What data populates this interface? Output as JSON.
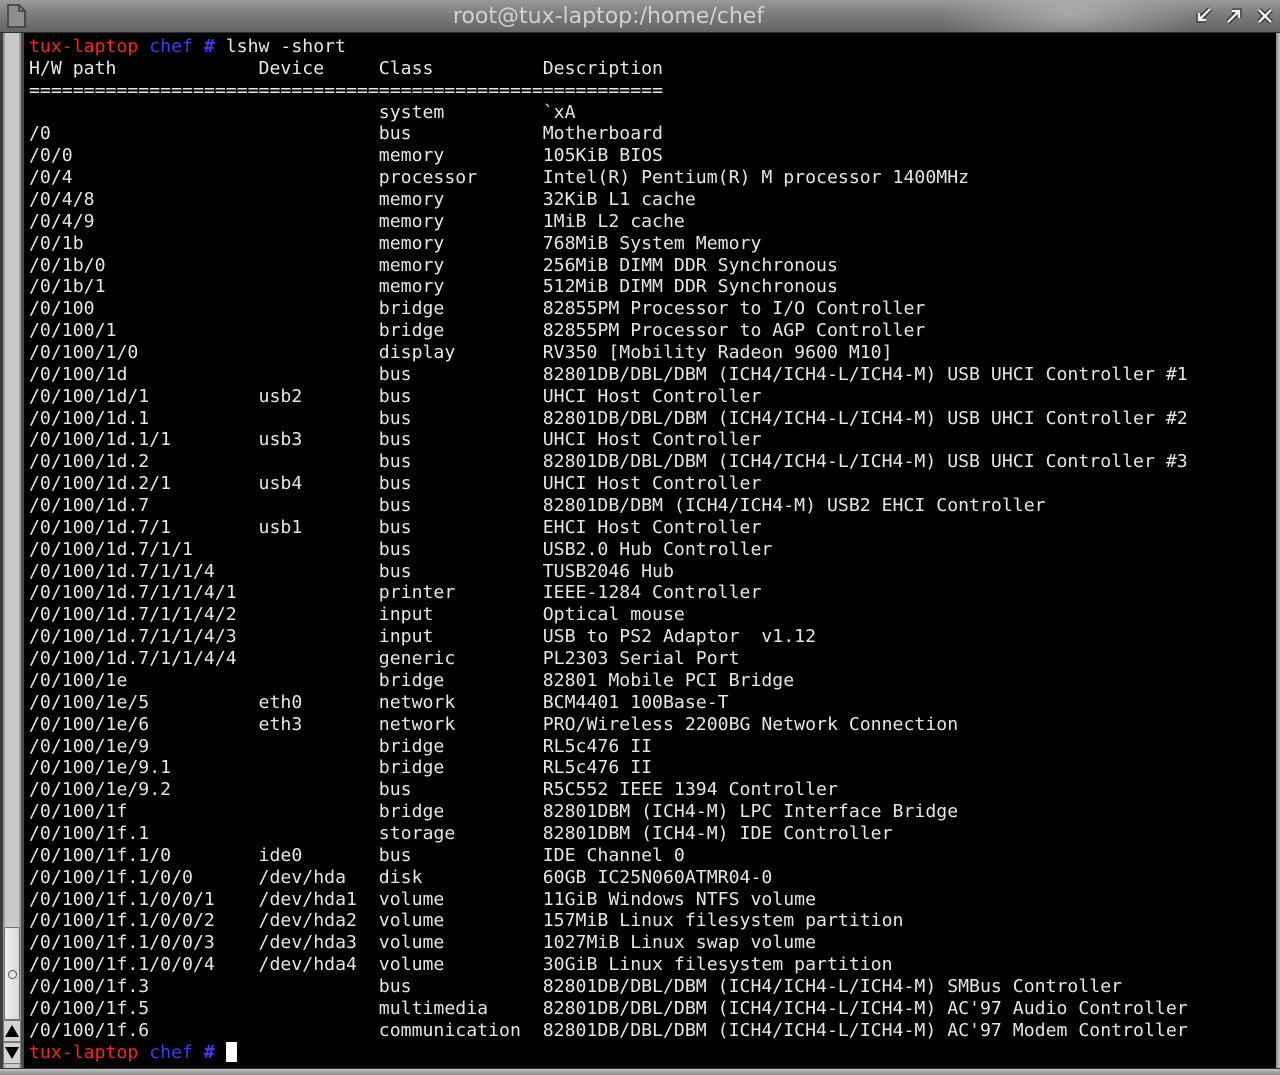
{
  "window": {
    "title": "root@tux-laptop:/home/chef",
    "menu_icon": "window-menu-icon",
    "button_icons": [
      "minimize-icon",
      "maximize-icon",
      "close-icon"
    ]
  },
  "colors": {
    "terminal_bg": "#000000",
    "terminal_fg": "#e6e6e6",
    "prompt_host": "#ff2222",
    "prompt_dir": "#3c3cff",
    "cursor": "#ffffff",
    "titlebar": "#7c7c7c",
    "title_text": "#d2d2d2"
  },
  "scrollbar": {
    "scroll_fraction": 1.0,
    "visible_fraction": 0.094
  },
  "terminal": {
    "prompt": {
      "host": "tux-laptop",
      "dir": "chef",
      "symbol": "#"
    },
    "command": "lshw -short",
    "headers": {
      "path": "H/W path",
      "device": "Device",
      "class": "Class",
      "description": "Description"
    },
    "separator": "==========================================================",
    "rows": [
      {
        "path": "",
        "device": "",
        "class": "system",
        "description": "`xA"
      },
      {
        "path": "/0",
        "device": "",
        "class": "bus",
        "description": "Motherboard"
      },
      {
        "path": "/0/0",
        "device": "",
        "class": "memory",
        "description": "105KiB BIOS"
      },
      {
        "path": "/0/4",
        "device": "",
        "class": "processor",
        "description": "Intel(R) Pentium(R) M processor 1400MHz"
      },
      {
        "path": "/0/4/8",
        "device": "",
        "class": "memory",
        "description": "32KiB L1 cache"
      },
      {
        "path": "/0/4/9",
        "device": "",
        "class": "memory",
        "description": "1MiB L2 cache"
      },
      {
        "path": "/0/1b",
        "device": "",
        "class": "memory",
        "description": "768MiB System Memory"
      },
      {
        "path": "/0/1b/0",
        "device": "",
        "class": "memory",
        "description": "256MiB DIMM DDR Synchronous"
      },
      {
        "path": "/0/1b/1",
        "device": "",
        "class": "memory",
        "description": "512MiB DIMM DDR Synchronous"
      },
      {
        "path": "/0/100",
        "device": "",
        "class": "bridge",
        "description": "82855PM Processor to I/O Controller"
      },
      {
        "path": "/0/100/1",
        "device": "",
        "class": "bridge",
        "description": "82855PM Processor to AGP Controller"
      },
      {
        "path": "/0/100/1/0",
        "device": "",
        "class": "display",
        "description": "RV350 [Mobility Radeon 9600 M10]"
      },
      {
        "path": "/0/100/1d",
        "device": "",
        "class": "bus",
        "description": "82801DB/DBL/DBM (ICH4/ICH4-L/ICH4-M) USB UHCI Controller #1"
      },
      {
        "path": "/0/100/1d/1",
        "device": "usb2",
        "class": "bus",
        "description": "UHCI Host Controller"
      },
      {
        "path": "/0/100/1d.1",
        "device": "",
        "class": "bus",
        "description": "82801DB/DBL/DBM (ICH4/ICH4-L/ICH4-M) USB UHCI Controller #2"
      },
      {
        "path": "/0/100/1d.1/1",
        "device": "usb3",
        "class": "bus",
        "description": "UHCI Host Controller"
      },
      {
        "path": "/0/100/1d.2",
        "device": "",
        "class": "bus",
        "description": "82801DB/DBL/DBM (ICH4/ICH4-L/ICH4-M) USB UHCI Controller #3"
      },
      {
        "path": "/0/100/1d.2/1",
        "device": "usb4",
        "class": "bus",
        "description": "UHCI Host Controller"
      },
      {
        "path": "/0/100/1d.7",
        "device": "",
        "class": "bus",
        "description": "82801DB/DBM (ICH4/ICH4-M) USB2 EHCI Controller"
      },
      {
        "path": "/0/100/1d.7/1",
        "device": "usb1",
        "class": "bus",
        "description": "EHCI Host Controller"
      },
      {
        "path": "/0/100/1d.7/1/1",
        "device": "",
        "class": "bus",
        "description": "USB2.0 Hub Controller"
      },
      {
        "path": "/0/100/1d.7/1/1/4",
        "device": "",
        "class": "bus",
        "description": "TUSB2046 Hub"
      },
      {
        "path": "/0/100/1d.7/1/1/4/1",
        "device": "",
        "class": "printer",
        "description": "IEEE-1284 Controller"
      },
      {
        "path": "/0/100/1d.7/1/1/4/2",
        "device": "",
        "class": "input",
        "description": "Optical mouse"
      },
      {
        "path": "/0/100/1d.7/1/1/4/3",
        "device": "",
        "class": "input",
        "description": "USB to PS2 Adaptor  v1.12"
      },
      {
        "path": "/0/100/1d.7/1/1/4/4",
        "device": "",
        "class": "generic",
        "description": "PL2303 Serial Port"
      },
      {
        "path": "/0/100/1e",
        "device": "",
        "class": "bridge",
        "description": "82801 Mobile PCI Bridge"
      },
      {
        "path": "/0/100/1e/5",
        "device": "eth0",
        "class": "network",
        "description": "BCM4401 100Base-T"
      },
      {
        "path": "/0/100/1e/6",
        "device": "eth3",
        "class": "network",
        "description": "PRO/Wireless 2200BG Network Connection"
      },
      {
        "path": "/0/100/1e/9",
        "device": "",
        "class": "bridge",
        "description": "RL5c476 II"
      },
      {
        "path": "/0/100/1e/9.1",
        "device": "",
        "class": "bridge",
        "description": "RL5c476 II"
      },
      {
        "path": "/0/100/1e/9.2",
        "device": "",
        "class": "bus",
        "description": "R5C552 IEEE 1394 Controller"
      },
      {
        "path": "/0/100/1f",
        "device": "",
        "class": "bridge",
        "description": "82801DBM (ICH4-M) LPC Interface Bridge"
      },
      {
        "path": "/0/100/1f.1",
        "device": "",
        "class": "storage",
        "description": "82801DBM (ICH4-M) IDE Controller"
      },
      {
        "path": "/0/100/1f.1/0",
        "device": "ide0",
        "class": "bus",
        "description": "IDE Channel 0"
      },
      {
        "path": "/0/100/1f.1/0/0",
        "device": "/dev/hda",
        "class": "disk",
        "description": "60GB IC25N060ATMR04-0"
      },
      {
        "path": "/0/100/1f.1/0/0/1",
        "device": "/dev/hda1",
        "class": "volume",
        "description": "11GiB Windows NTFS volume"
      },
      {
        "path": "/0/100/1f.1/0/0/2",
        "device": "/dev/hda2",
        "class": "volume",
        "description": "157MiB Linux filesystem partition"
      },
      {
        "path": "/0/100/1f.1/0/0/3",
        "device": "/dev/hda3",
        "class": "volume",
        "description": "1027MiB Linux swap volume"
      },
      {
        "path": "/0/100/1f.1/0/0/4",
        "device": "/dev/hda4",
        "class": "volume",
        "description": "30GiB Linux filesystem partition"
      },
      {
        "path": "/0/100/1f.3",
        "device": "",
        "class": "bus",
        "description": "82801DB/DBL/DBM (ICH4/ICH4-L/ICH4-M) SMBus Controller"
      },
      {
        "path": "/0/100/1f.5",
        "device": "",
        "class": "multimedia",
        "description": "82801DB/DBL/DBM (ICH4/ICH4-L/ICH4-M) AC'97 Audio Controller"
      },
      {
        "path": "/0/100/1f.6",
        "device": "",
        "class": "communication",
        "description": "82801DB/DBL/DBM (ICH4/ICH4-L/ICH4-M) AC'97 Modem Controller"
      }
    ]
  }
}
